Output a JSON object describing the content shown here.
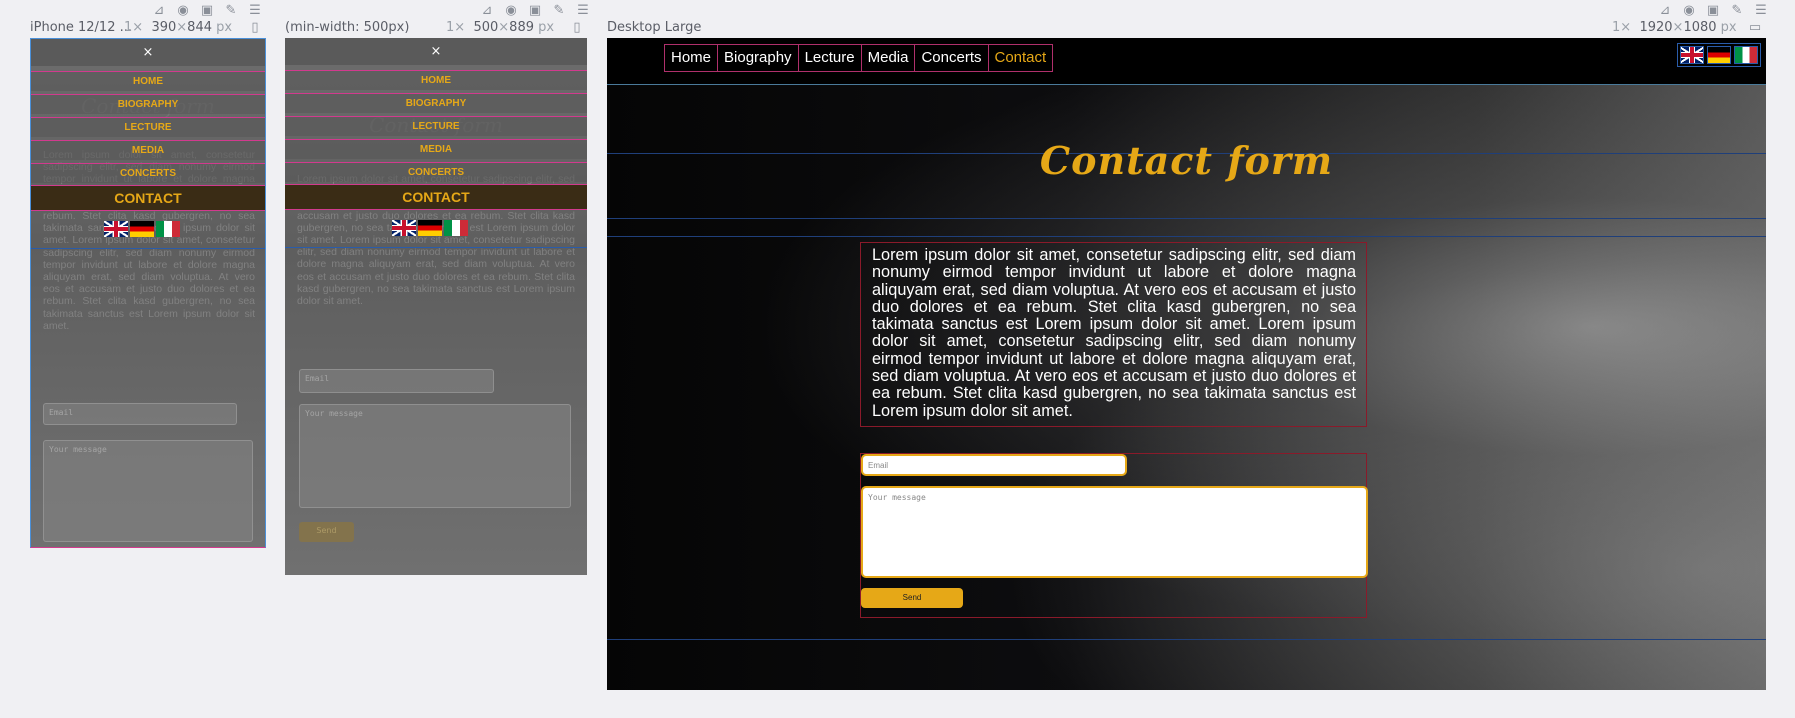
{
  "frames": {
    "mobile": {
      "label": "iPhone 12/12 ...",
      "scale": "1×",
      "width": "390",
      "height": "844",
      "unit": "px"
    },
    "tablet": {
      "label": "(min-width: 500px)",
      "scale": "1×",
      "width": "500",
      "height": "889",
      "unit": "px"
    },
    "desktop": {
      "label": "Desktop Large",
      "scale": "1×",
      "width": "1920",
      "height": "1080",
      "unit": "px"
    }
  },
  "menu": {
    "close": "×",
    "items": [
      "HOME",
      "BIOGRAPHY",
      "LECTURE",
      "MEDIA",
      "CONCERTS"
    ],
    "active": "CONTACT"
  },
  "nav": {
    "items": [
      "Home",
      "Biography",
      "Lecture",
      "Media",
      "Concerts",
      "Contact"
    ],
    "active_index": 5
  },
  "flags": [
    "uk-flag-icon",
    "german-flag-icon",
    "italian-flag-icon"
  ],
  "page": {
    "title": "Contact form",
    "mobile_title": "Contact form",
    "body": "Lorem ipsum dolor sit amet, consetetur sadipscing elitr, sed diam nonumy eirmod tempor invidunt ut labore et dolore magna aliquyam erat, sed diam voluptua. At vero eos et accusam et justo duo dolores et ea rebum. Stet clita kasd gubergren, no sea takimata sanctus est Lorem ipsum dolor sit amet. Lorem ipsum dolor sit amet, consetetur sadipscing elitr, sed diam nonumy eirmod tempor invidunt ut labore et dolore magna aliquyam erat, sed diam voluptua. At vero eos et accusam et justo duo dolores et ea rebum. Stet clita kasd gubergren, no sea takimata sanctus est Lorem ipsum dolor sit amet."
  },
  "form": {
    "email_placeholder": "Email",
    "message_placeholder": "Your message",
    "send_label": "Send"
  },
  "colors": {
    "accent": "#e6a817",
    "nav_border": "#b0306c",
    "guide_blue": "#2a5caa"
  }
}
